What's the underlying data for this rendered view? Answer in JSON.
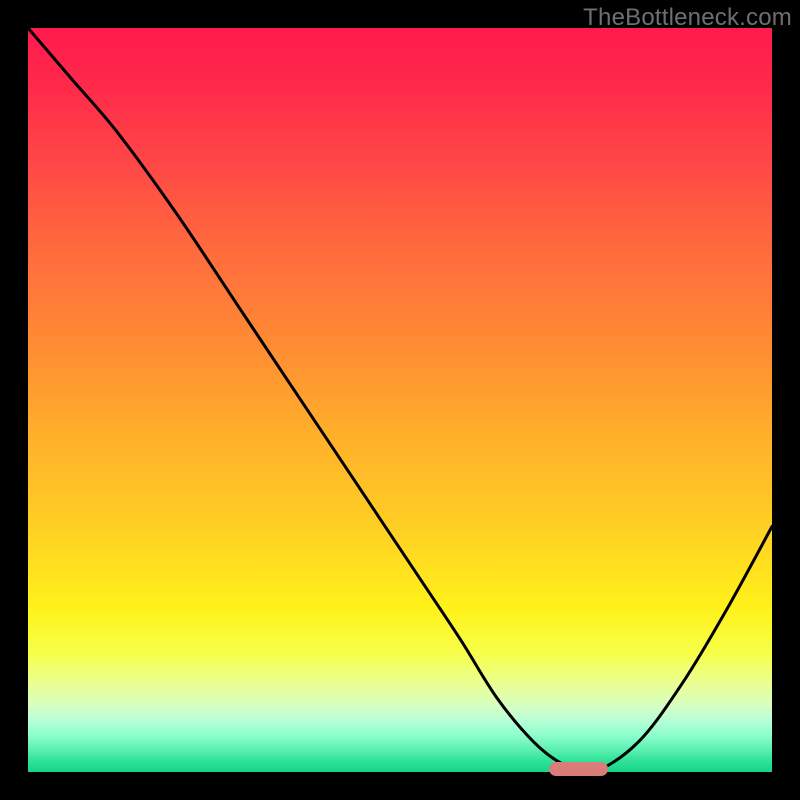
{
  "watermark": "TheBottleneck.com",
  "colors": {
    "frame": "#000000",
    "curve": "#000000",
    "marker": "#da7c7a"
  },
  "chart_data": {
    "type": "line",
    "title": "",
    "xlabel": "",
    "ylabel": "",
    "xlim": [
      0,
      100
    ],
    "ylim": [
      0,
      100
    ],
    "grid": false,
    "legend": false,
    "series": [
      {
        "name": "bottleneck-curve",
        "x": [
          0,
          6,
          12,
          20,
          28,
          36,
          44,
          52,
          58,
          63,
          68,
          72,
          76,
          82,
          88,
          94,
          100
        ],
        "values": [
          100,
          93,
          86,
          75,
          63,
          51,
          39,
          27,
          18,
          10,
          4,
          1,
          0,
          4,
          12,
          22,
          33
        ]
      }
    ],
    "marker": {
      "x_start": 70,
      "x_end": 78,
      "y": 0
    }
  }
}
